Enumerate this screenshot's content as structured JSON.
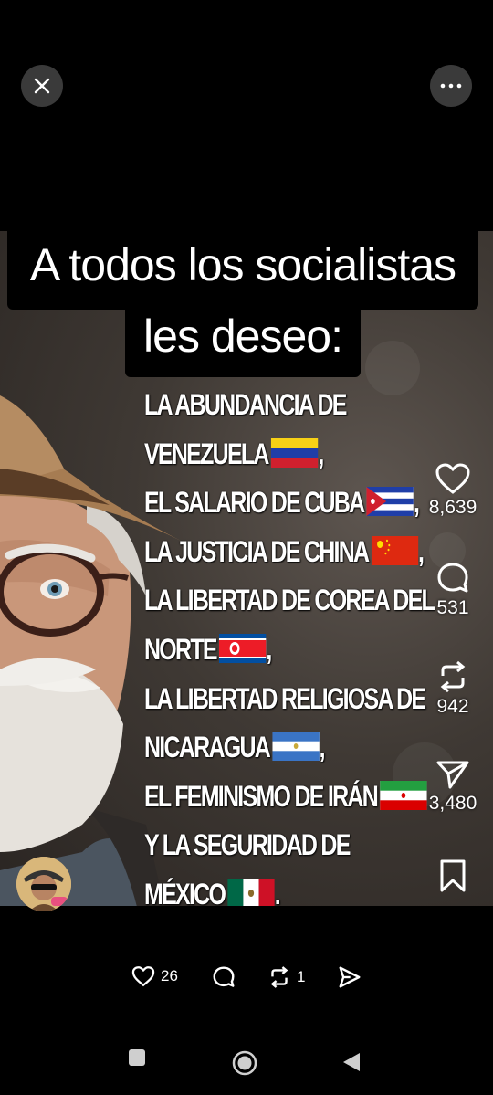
{
  "top_bar": {
    "close_icon": "close-icon",
    "more_icon": "more-options-icon"
  },
  "post": {
    "headline_line1": "A todos los socialistas",
    "headline_line2": "les deseo:",
    "wishes": [
      {
        "text": "LA ABUNDANCIA DE",
        "flag": null
      },
      {
        "text": "VENEZUELA",
        "flag": "venezuela",
        "suffix": ","
      },
      {
        "text": "EL SALARIO DE CUBA",
        "flag": "cuba",
        "suffix": ","
      },
      {
        "text": "LA JUSTICIA DE CHINA",
        "flag": "china",
        "suffix": ","
      },
      {
        "text": "LA LIBERTAD DE COREA DEL",
        "flag": null
      },
      {
        "text": "NORTE",
        "flag": "north-korea",
        "suffix": ","
      },
      {
        "text": "LA LIBERTAD RELIGIOSA DE",
        "flag": null
      },
      {
        "text": "NICARAGUA",
        "flag": "nicaragua",
        "suffix": ","
      },
      {
        "text": "EL FEMINISMO DE IRÁN",
        "flag": "iran",
        "suffix": ""
      },
      {
        "text": "Y LA SEGURIDAD DE",
        "flag": null
      },
      {
        "text": "MÉXICO",
        "flag": "mexico",
        "suffix": "."
      }
    ]
  },
  "actions": {
    "likes": "8,639",
    "comments": "531",
    "reposts": "942",
    "shares": "3,480"
  },
  "bottom_bar": {
    "likes": "26",
    "reposts": "1"
  }
}
